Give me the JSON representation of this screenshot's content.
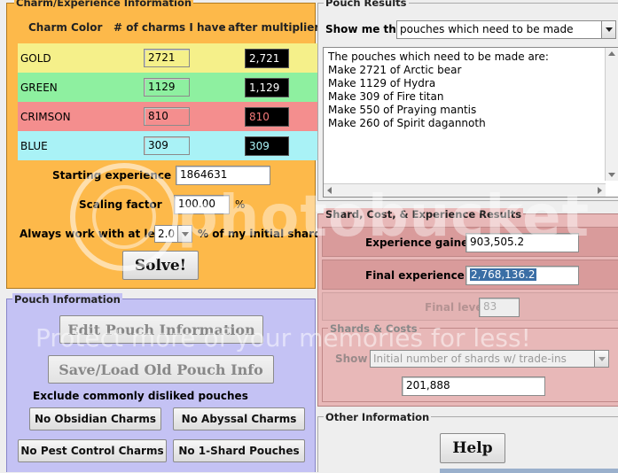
{
  "charm_panel": {
    "title": "Charm/Experience Information",
    "col_color": "Charm Color",
    "col_have": "# of charms I have",
    "col_mult": "- after multiplier",
    "rows": [
      {
        "name": "GOLD",
        "have": "2721",
        "mult": "2,721",
        "bg": "#f5f08a",
        "mult_color": "#ffffff"
      },
      {
        "name": "GREEN",
        "have": "1129",
        "mult": "1,129",
        "bg": "#8ef0a0",
        "mult_color": "#ffffff"
      },
      {
        "name": "CRIMSON",
        "have": "810",
        "mult": "810",
        "bg": "#f48e8e",
        "mult_color": "#f47a7a"
      },
      {
        "name": "BLUE",
        "have": "309",
        "mult": "309",
        "bg": "#a9f2f6",
        "mult_color": "#aaf4f8"
      }
    ],
    "starting_exp_label": "Starting experience",
    "starting_exp_value": "1864631",
    "scaling_label": "Scaling factor",
    "scaling_value": "100.00",
    "scaling_unit": "%",
    "always_label": "Always work with at least",
    "always_value": "2.0",
    "always_suffix": "% of my initial shards",
    "solve_label": "Solve!"
  },
  "pouch_info": {
    "title": "Pouch Information",
    "edit_label": "Edit Pouch Information",
    "save_label": "Save/Load Old Pouch Info",
    "exclude_label": "Exclude commonly disliked pouches",
    "btn_obsidian": "No Obsidian Charms",
    "btn_abyssal": "No Abyssal Charms",
    "btn_pest": "No Pest Control Charms",
    "btn_oneshard": "No 1-Shard Pouches"
  },
  "pouch_results": {
    "title": "Pouch Results",
    "show_label": "Show me the",
    "show_value": "pouches which need to be made",
    "lines": [
      "The pouches which need to be made are:",
      "Make 2721 of Arctic bear",
      "Make 1129 of Hydra",
      "Make 309 of Fire titan",
      "Make 550 of Praying mantis",
      "Make 260 of Spirit dagannoth"
    ]
  },
  "shard_results": {
    "title": "Shard, Cost, & Experience Results",
    "exp_gained_label": "Experience gained",
    "exp_gained_value": "903,505.2",
    "final_exp_label": "Final experience",
    "final_exp_value": "2,768,136.2",
    "final_level_label": "Final level",
    "final_level_value": "83",
    "shards_title": "Shards & Costs",
    "show_label": "Show",
    "show_value": "Initial number of shards w/ trade-ins",
    "shards_value": "201,888"
  },
  "other_info": {
    "title": "Other Information",
    "help_label": "Help"
  },
  "watermark": {
    "brand": "photobucket",
    "tagline": "Protect more of your memories for less!"
  },
  "colors": {
    "charm_bg": "#fdb94a",
    "pouch_bg": "#c4c2f4",
    "shard_bg": "#d99b9b"
  }
}
